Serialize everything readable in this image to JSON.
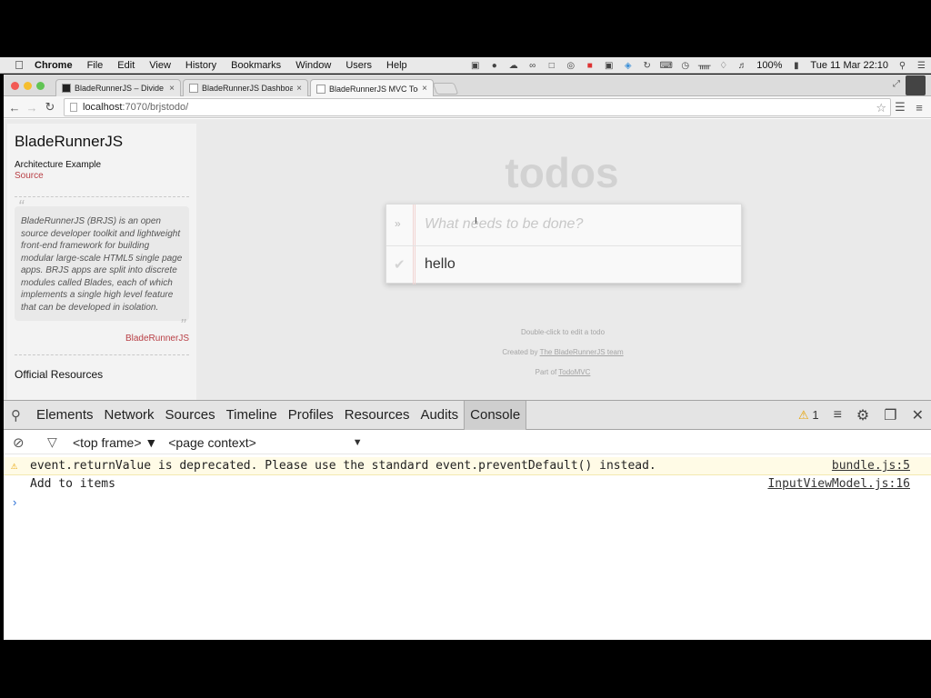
{
  "menubar": {
    "app_name": "Chrome",
    "menus": [
      "File",
      "Edit",
      "View",
      "History",
      "Bookmarks",
      "Window",
      "Users",
      "Help"
    ],
    "battery": "100%",
    "datetime": "Tue 11 Mar  22:10"
  },
  "tabs": [
    {
      "title": "BladeRunnerJS – Divide & c",
      "close": "×"
    },
    {
      "title": "BladeRunnerJS Dashboard",
      "close": "×"
    },
    {
      "title": "BladeRunnerJS MVC Todo",
      "close": "×"
    }
  ],
  "address": {
    "host": "localhost",
    "rest": ":7070/brjstodo/"
  },
  "sidebar": {
    "title": "BladeRunnerJS",
    "subtitle": "Architecture Example",
    "source_link": "Source",
    "quote": "BladeRunnerJS (BRJS) is an open source developer toolkit and lightweight front-end framework for building modular large-scale HTML5 single page apps. BRJS apps are split into discrete modules called Blades, each of which implements a single high level feature that can be developed in isolation.",
    "quote_by": "BladeRunnerJS",
    "resources_heading": "Official Resources"
  },
  "todo": {
    "title": "todos",
    "placeholder": "What needs to be done?",
    "items": [
      {
        "label": "hello",
        "completed": false
      }
    ]
  },
  "footer": {
    "hint": "Double-click to edit a todo",
    "created_prefix": "Created by ",
    "created_link": "The BladeRunnerJS team",
    "part_prefix": "Part of ",
    "part_link": "TodoMVC"
  },
  "devtools": {
    "tabs": [
      "Elements",
      "Network",
      "Sources",
      "Timeline",
      "Profiles",
      "Resources",
      "Audits",
      "Console"
    ],
    "active_tab": "Console",
    "warning_count": "1",
    "frame_select": "<top frame>",
    "context_select": "<page context>",
    "messages": [
      {
        "level": "warning",
        "text": "event.returnValue is deprecated. Please use the standard event.preventDefault() instead.",
        "source": "bundle.js:5"
      },
      {
        "level": "log",
        "text": "Add to items",
        "source": "InputViewModel.js:16"
      }
    ],
    "prompt": "›"
  },
  "colors": {
    "accent_red": "#b83f45",
    "warning": "#e7a200",
    "console_prompt": "#2a6fd6"
  }
}
